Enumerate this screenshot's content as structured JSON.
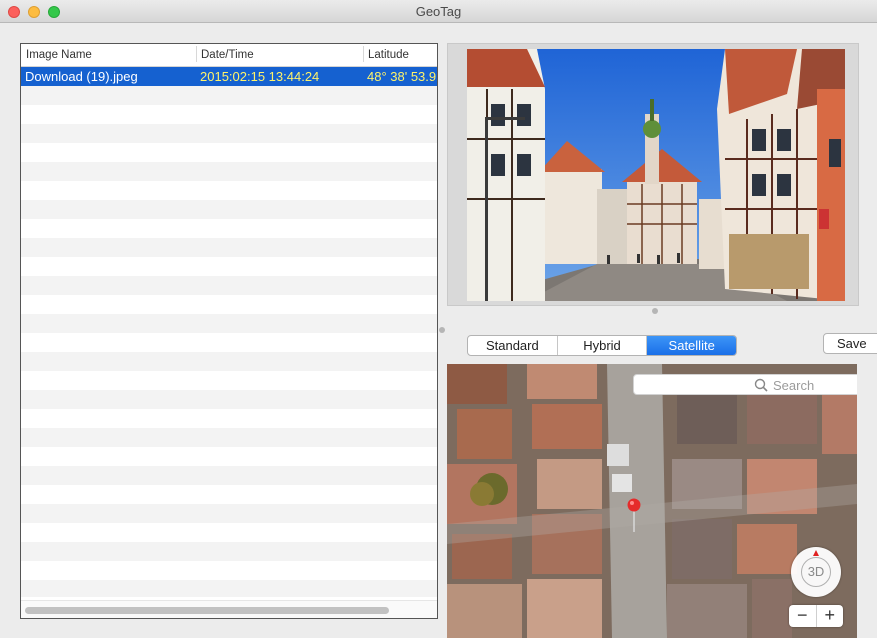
{
  "window": {
    "title": "GeoTag"
  },
  "table": {
    "columns": [
      "Image Name",
      "Date/Time",
      "Latitude"
    ],
    "rows": [
      {
        "name": "Download (19).jpeg",
        "datetime": "2015:02:15 13:44:24",
        "latitude": "48° 38' 53.9"
      }
    ]
  },
  "map": {
    "types": [
      "Standard",
      "Hybrid",
      "Satellite"
    ],
    "selected_type": "Satellite",
    "save_label": "Save",
    "search_placeholder": "Search",
    "compass_label": "3D",
    "zoom_out": "−",
    "zoom_in": "+"
  },
  "colors": {
    "selection": "#1561d0",
    "selection_text": "#fff36a",
    "segment_active": "#1a6fe8",
    "pin": "#e52b2b"
  }
}
